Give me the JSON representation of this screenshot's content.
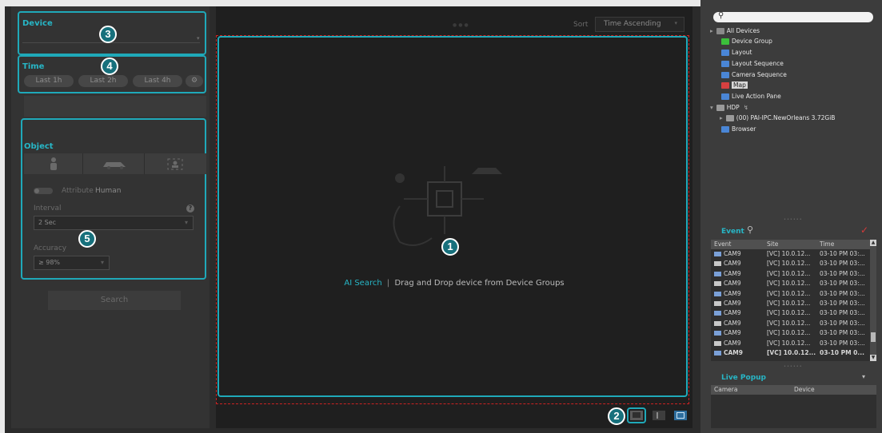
{
  "callouts": [
    "1",
    "2",
    "3",
    "4",
    "5"
  ],
  "left": {
    "device_label": "Device",
    "time_label": "Time",
    "time_buttons": [
      "Last 1h",
      "Last 2h",
      "Last 4h"
    ],
    "object_label": "Object",
    "attribute_label": "Attribute",
    "attribute_value": "Human",
    "interval_label": "Interval",
    "interval_value": "2 Sec",
    "accuracy_label": "Accuracy",
    "accuracy_value": "≥ 98%",
    "search_button": "Search"
  },
  "center": {
    "sort_label": "Sort",
    "sort_value": "Time Ascending",
    "hint_prefix": "AI Search",
    "hint_separator": "|",
    "hint_text": "Drag and Drop device from Device Groups"
  },
  "tree": {
    "items": [
      {
        "label": "All Devices",
        "icon": "all-devices-icon",
        "color": "#8a8a8a"
      },
      {
        "label": "Device Group",
        "icon": "device-group-icon",
        "color": "#3bbf3b"
      },
      {
        "label": "Layout",
        "icon": "layout-icon",
        "color": "#4a86d6"
      },
      {
        "label": "Layout Sequence",
        "icon": "layout-sequence-icon",
        "color": "#4a86d6"
      },
      {
        "label": "Camera Sequence",
        "icon": "camera-sequence-icon",
        "color": "#4a86d6"
      },
      {
        "label": "Map",
        "icon": "map-icon",
        "color": "#d64040"
      },
      {
        "label": "Live Action Pane",
        "icon": "live-action-icon",
        "color": "#4a86d6"
      },
      {
        "label": "HDP",
        "icon": "hdp-icon",
        "color": "#9a9a9a"
      },
      {
        "label": "(00) PAI-IPC.NewOrleans 3.72GiB",
        "icon": "camera-icon",
        "color": "#9a9a9a"
      },
      {
        "label": "Browser",
        "icon": "browser-icon",
        "color": "#4a86d6"
      }
    ]
  },
  "event": {
    "title": "Event",
    "columns": [
      "Event",
      "Site",
      "Time"
    ],
    "rows": [
      {
        "event": "CAM9",
        "site": "[VC] 10.0.12...",
        "time": "03-10 PM 03:..."
      },
      {
        "event": "CAM9",
        "site": "[VC] 10.0.12...",
        "time": "03-10 PM 03:..."
      },
      {
        "event": "CAM9",
        "site": "[VC] 10.0.12...",
        "time": "03-10 PM 03:..."
      },
      {
        "event": "CAM9",
        "site": "[VC] 10.0.12...",
        "time": "03-10 PM 03:..."
      },
      {
        "event": "CAM9",
        "site": "[VC] 10.0.12...",
        "time": "03-10 PM 03:..."
      },
      {
        "event": "CAM9",
        "site": "[VC] 10.0.12...",
        "time": "03-10 PM 03:..."
      },
      {
        "event": "CAM9",
        "site": "[VC] 10.0.12...",
        "time": "03-10 PM 03:..."
      },
      {
        "event": "CAM9",
        "site": "[VC] 10.0.12...",
        "time": "03-10 PM 03:..."
      },
      {
        "event": "CAM9",
        "site": "[VC] 10.0.12...",
        "time": "03-10 PM 03:..."
      },
      {
        "event": "CAM9",
        "site": "[VC] 10.0.12...",
        "time": "03-10 PM 03:..."
      },
      {
        "event": "CAM9",
        "site": "[VC] 10.0.12...",
        "time": "03-10 PM 0..."
      }
    ]
  },
  "live_popup": {
    "title": "Live Popup",
    "columns": [
      "Camera",
      "Device"
    ]
  },
  "colors": {
    "accent": "#1fa9b9",
    "callout_fill": "#17707c",
    "drop_border": "#cc2222"
  }
}
